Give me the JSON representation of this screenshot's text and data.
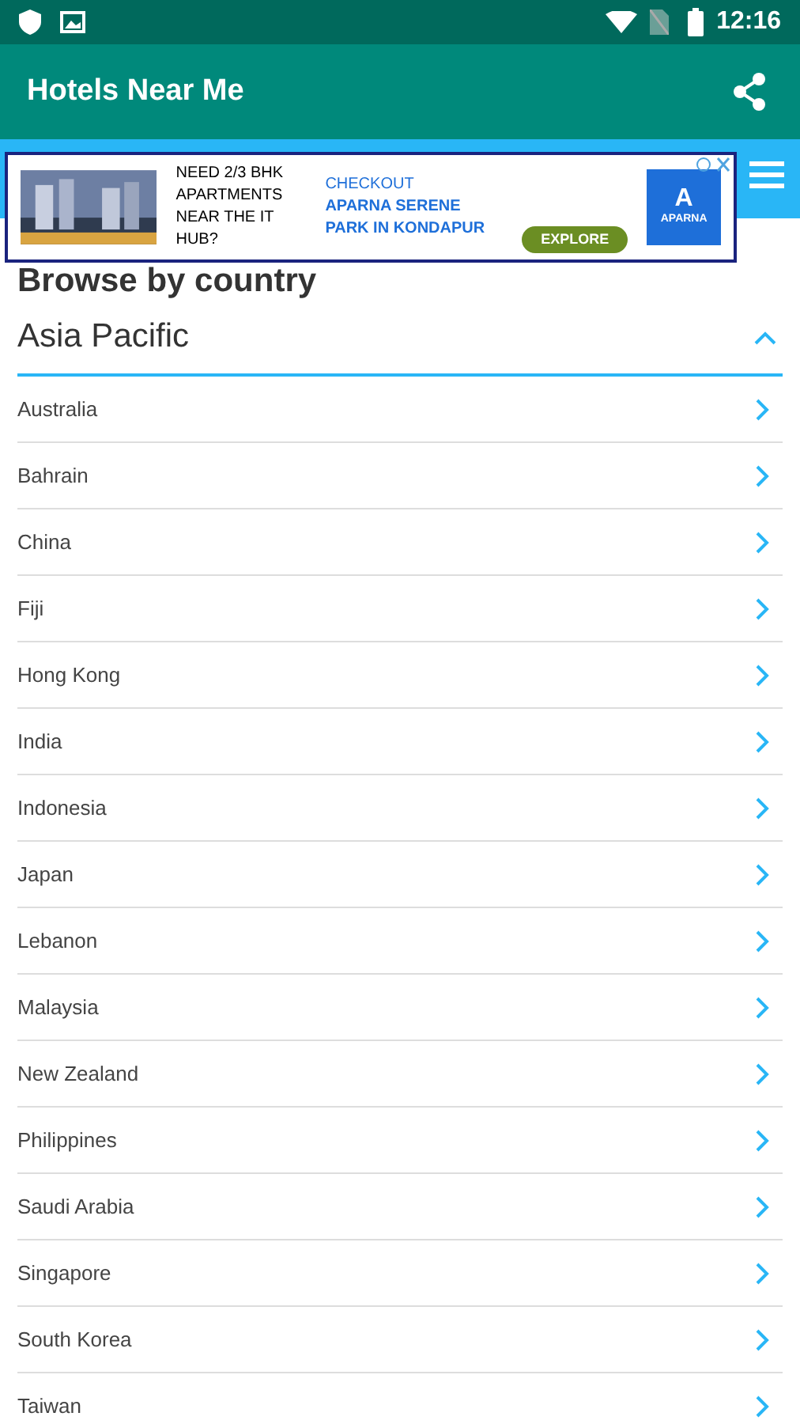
{
  "status_bar": {
    "time": "12:16"
  },
  "app_bar": {
    "title": "Hotels Near Me"
  },
  "ad": {
    "text_1": "NEED 2/3 BHK APARTMENTS NEAR THE IT HUB?",
    "text_2": "CHECKOUT",
    "text_3": "APARNA SERENE PARK IN KONDAPUR",
    "button": "EXPLORE",
    "logo_letter": "A",
    "logo_name": "APARNA"
  },
  "heading": "Browse by country",
  "section": {
    "title": "Asia Pacific",
    "expanded": true
  },
  "countries": [
    {
      "name": "Australia"
    },
    {
      "name": "Bahrain"
    },
    {
      "name": "China"
    },
    {
      "name": "Fiji"
    },
    {
      "name": "Hong Kong"
    },
    {
      "name": "India"
    },
    {
      "name": "Indonesia"
    },
    {
      "name": "Japan"
    },
    {
      "name": "Lebanon"
    },
    {
      "name": "Malaysia"
    },
    {
      "name": "New Zealand"
    },
    {
      "name": "Philippines"
    },
    {
      "name": "Saudi Arabia"
    },
    {
      "name": "Singapore"
    },
    {
      "name": "South Korea"
    },
    {
      "name": "Taiwan"
    }
  ]
}
